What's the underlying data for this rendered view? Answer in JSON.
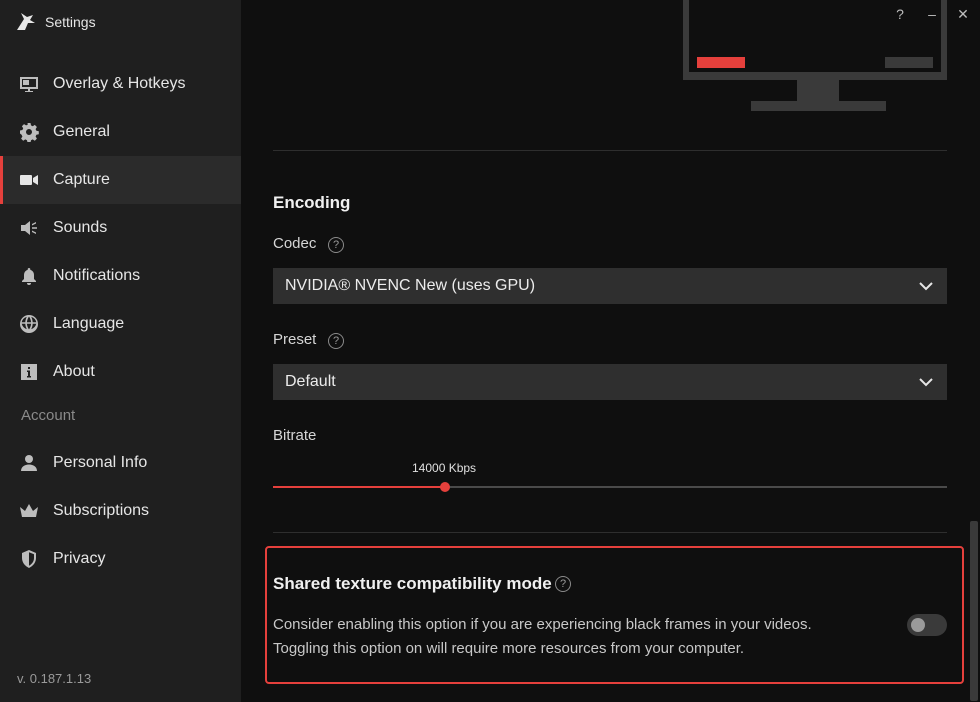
{
  "app": {
    "title": "Settings"
  },
  "window": {
    "help": "?",
    "minimize": "–",
    "close": "✕"
  },
  "sidebar": {
    "items": [
      {
        "label": "Overlay & Hotkeys",
        "icon": "overlay-icon"
      },
      {
        "label": "General",
        "icon": "gear-icon"
      },
      {
        "label": "Capture",
        "icon": "camera-icon",
        "active": true
      },
      {
        "label": "Sounds",
        "icon": "speaker-icon"
      },
      {
        "label": "Notifications",
        "icon": "bell-icon"
      },
      {
        "label": "Language",
        "icon": "globe-icon"
      },
      {
        "label": "About",
        "icon": "info-icon"
      }
    ],
    "account_label": "Account",
    "account_items": [
      {
        "label": "Personal Info",
        "icon": "user-icon"
      },
      {
        "label": "Subscriptions",
        "icon": "crown-icon"
      },
      {
        "label": "Privacy",
        "icon": "shield-icon"
      }
    ],
    "version": "v. 0.187.1.13"
  },
  "main": {
    "encoding_heading": "Encoding",
    "codec": {
      "label": "Codec",
      "value": "NVIDIA® NVENC New (uses GPU)"
    },
    "preset": {
      "label": "Preset",
      "value": "Default"
    },
    "bitrate": {
      "label": "Bitrate",
      "value_text": "14000 Kbps",
      "fraction": 0.255
    },
    "shared_texture": {
      "heading": "Shared texture compatibility mode",
      "line1": "Consider enabling this option if you are experiencing black frames in your videos.",
      "line2": "Toggling this option on will require more resources from your computer.",
      "enabled": false
    }
  },
  "colors": {
    "accent": "#e5403c",
    "sidebar_bg": "#1f1f1f",
    "main_bg": "#0f0f0f"
  }
}
